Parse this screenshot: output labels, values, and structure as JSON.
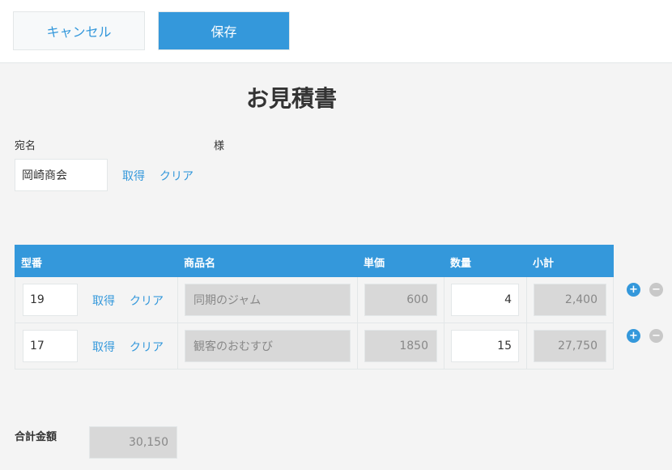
{
  "toolbar": {
    "cancel_label": "キャンセル",
    "save_label": "保存"
  },
  "form": {
    "title": "お見積書",
    "recipient_label": "宛名",
    "honorific": "様",
    "recipient_value": "岡崎商会",
    "fetch_label": "取得",
    "clear_label": "クリア"
  },
  "table": {
    "headers": {
      "model": "型番",
      "product": "商品名",
      "unit_price": "単価",
      "quantity": "数量",
      "subtotal": "小計"
    },
    "rows": [
      {
        "model": "19",
        "product": "同期のジャム",
        "unit_price": "600",
        "quantity": "4",
        "subtotal": "2,400"
      },
      {
        "model": "17",
        "product": "観客のおむすび",
        "unit_price": "1850",
        "quantity": "15",
        "subtotal": "27,750"
      }
    ],
    "add_symbol": "+",
    "remove_symbol": "−"
  },
  "total": {
    "label": "合計金額",
    "value": "30,150"
  },
  "colors": {
    "accent": "#3498db",
    "readonly_bg": "#d8d8d8",
    "page_bg": "#f4f4f4"
  }
}
